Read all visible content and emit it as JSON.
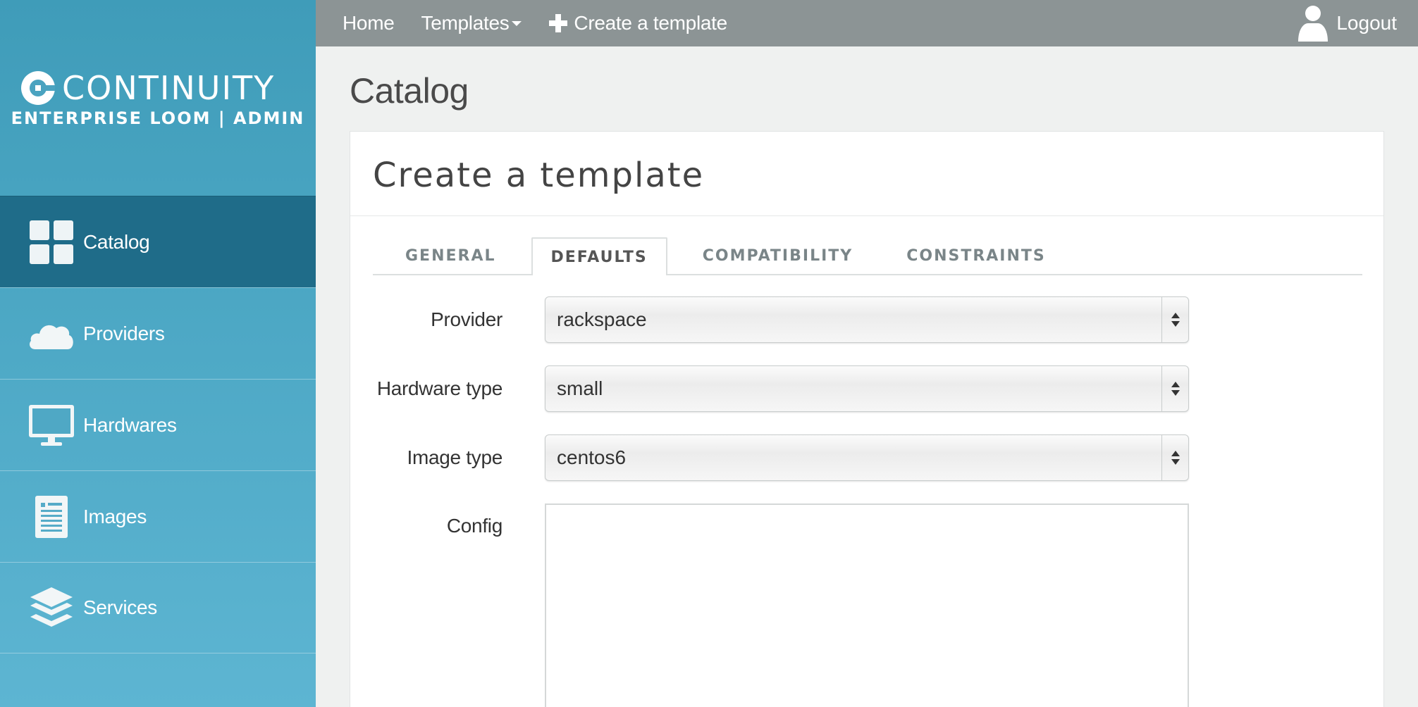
{
  "brand": {
    "name": "CONTINUITY",
    "subtitle": "ENTERPRISE LOOM | ADMIN",
    "color": "#4aa3c0"
  },
  "sidebar": {
    "items": [
      {
        "label": "Catalog",
        "icon": "grid-icon",
        "active": true
      },
      {
        "label": "Providers",
        "icon": "cloud-icon",
        "active": false
      },
      {
        "label": "Hardwares",
        "icon": "monitor-icon",
        "active": false
      },
      {
        "label": "Images",
        "icon": "document-icon",
        "active": false
      },
      {
        "label": "Services",
        "icon": "layers-icon",
        "active": false
      }
    ]
  },
  "topbar": {
    "home": "Home",
    "templates": "Templates",
    "create": "Create a template",
    "logout": "Logout"
  },
  "page": {
    "title": "Catalog",
    "panel_title": "Create a template"
  },
  "tabs": [
    {
      "label": "GENERAL",
      "active": false
    },
    {
      "label": "DEFAULTS",
      "active": true
    },
    {
      "label": "COMPATIBILITY",
      "active": false
    },
    {
      "label": "CONSTRAINTS",
      "active": false
    }
  ],
  "form": {
    "provider": {
      "label": "Provider",
      "value": "rackspace"
    },
    "hardware": {
      "label": "Hardware type",
      "value": "small"
    },
    "image": {
      "label": "Image type",
      "value": "centos6"
    },
    "config": {
      "label": "Config",
      "value": ""
    }
  }
}
